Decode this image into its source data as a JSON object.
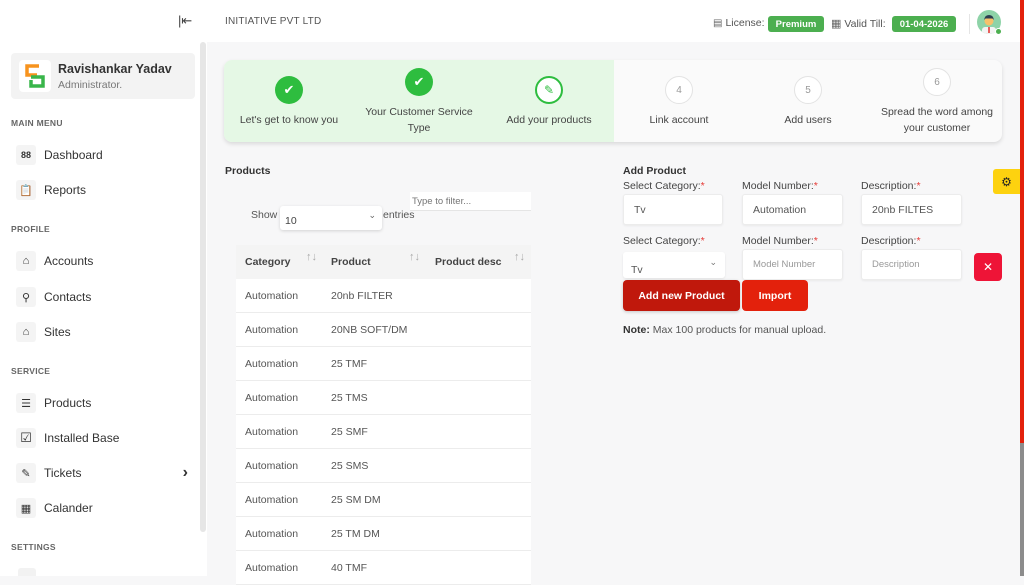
{
  "sidebar": {
    "collapse_icon": "|⇤",
    "user": {
      "name": "Ravishankar Yadav",
      "role": "Administrator."
    },
    "sections": [
      {
        "label": "MAIN MENU",
        "items": [
          {
            "label": "Dashboard",
            "icon": "dashboard-icon",
            "glyph": "88"
          },
          {
            "label": "Reports",
            "icon": "reports-icon",
            "glyph": "📋"
          }
        ]
      },
      {
        "label": "PROFILE",
        "items": [
          {
            "label": "Accounts",
            "icon": "building-icon",
            "glyph": "⌂"
          },
          {
            "label": "Contacts",
            "icon": "contact-icon",
            "glyph": "⚲"
          },
          {
            "label": "Sites",
            "icon": "home-icon",
            "glyph": "⌂"
          }
        ]
      },
      {
        "label": "SERVICE",
        "items": [
          {
            "label": "Products",
            "icon": "list-icon",
            "glyph": "☰"
          },
          {
            "label": "Installed Base",
            "icon": "checkbox-icon",
            "glyph": "☑"
          },
          {
            "label": "Tickets",
            "icon": "ticket-icon",
            "glyph": "✎",
            "chevron": "›"
          },
          {
            "label": "Calander",
            "icon": "calendar-icon",
            "glyph": "▦"
          }
        ]
      },
      {
        "label": "SETTINGS",
        "items": []
      }
    ]
  },
  "topbar": {
    "company": "INITIATIVE PVT LTD",
    "license_label": "License:",
    "license_value": "Premium",
    "valid_label": "Valid Till:",
    "valid_value": "01-04-2026"
  },
  "stepper": {
    "steps": [
      {
        "label": "Let's get to know you",
        "status": "done",
        "marker": "✔"
      },
      {
        "label": "Your Customer Service Type",
        "status": "done",
        "marker": "✔"
      },
      {
        "label": "Add your products",
        "status": "active",
        "marker": "✎"
      },
      {
        "label": "Link account",
        "status": "todo",
        "marker": "4"
      },
      {
        "label": "Add users",
        "status": "todo",
        "marker": "5"
      },
      {
        "label": "Spread the word among your customer",
        "status": "todo",
        "marker": "6"
      }
    ]
  },
  "products": {
    "title": "Products",
    "filter_placeholder": "Type to filter...",
    "show_label": "Show",
    "entries_label": "entries",
    "page_size": "10",
    "columns": [
      "Category",
      "Product",
      "Product desc"
    ],
    "rows": [
      [
        "Automation",
        "20nb FILTER",
        ""
      ],
      [
        "Automation",
        "20NB SOFT/DM",
        ""
      ],
      [
        "Automation",
        "25 TMF",
        ""
      ],
      [
        "Automation",
        "25 TMS",
        ""
      ],
      [
        "Automation",
        "25 SMF",
        ""
      ],
      [
        "Automation",
        "25 SMS",
        ""
      ],
      [
        "Automation",
        "25 SM DM",
        ""
      ],
      [
        "Automation",
        "25 TM DM",
        ""
      ],
      [
        "Automation",
        "40 TMF",
        ""
      ]
    ]
  },
  "add_product": {
    "title": "Add Product",
    "category_label": "Select Category:",
    "model_label": "Model Number:",
    "description_label": "Description:",
    "required_mark": "*",
    "row1": {
      "category": "Tv",
      "model": "Automation",
      "description": "20nb FILTES"
    },
    "row2": {
      "category": "Tv",
      "model_placeholder": "Model Number",
      "description_placeholder": "Description"
    },
    "remove_icon": "✕",
    "add_button": "Add new Product",
    "import_button": "Import",
    "note_bold": "Note:",
    "note_text": " Max 100 products for manual upload."
  },
  "colors": {
    "accent_green": "#2ebd3f",
    "badge_green": "#4caf50",
    "primary_red": "#e3210c",
    "delete_red": "#ee1437",
    "settings_yellow": "#fdd20f"
  }
}
